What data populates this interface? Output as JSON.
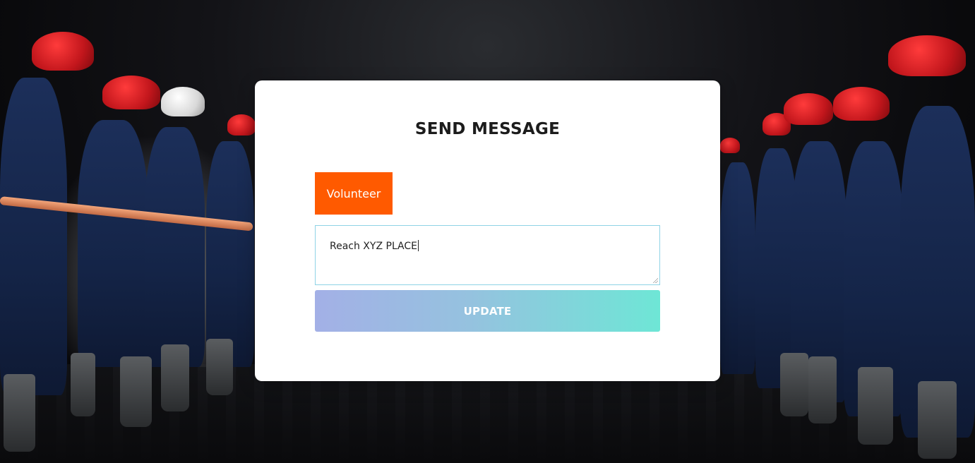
{
  "form": {
    "title": "SEND MESSAGE",
    "tag_button_label": "Volunteer",
    "message_value": "Reach XYZ PLACE",
    "submit_label": "UPDATE"
  },
  "colors": {
    "tag_button_bg": "#ff5a00",
    "submit_gradient_start": "#a3b0e6",
    "submit_gradient_end": "#6ee6d6",
    "input_border": "#8fd3e6",
    "card_bg": "#ffffff"
  },
  "background": {
    "description_icon": "firefighters-photo"
  }
}
